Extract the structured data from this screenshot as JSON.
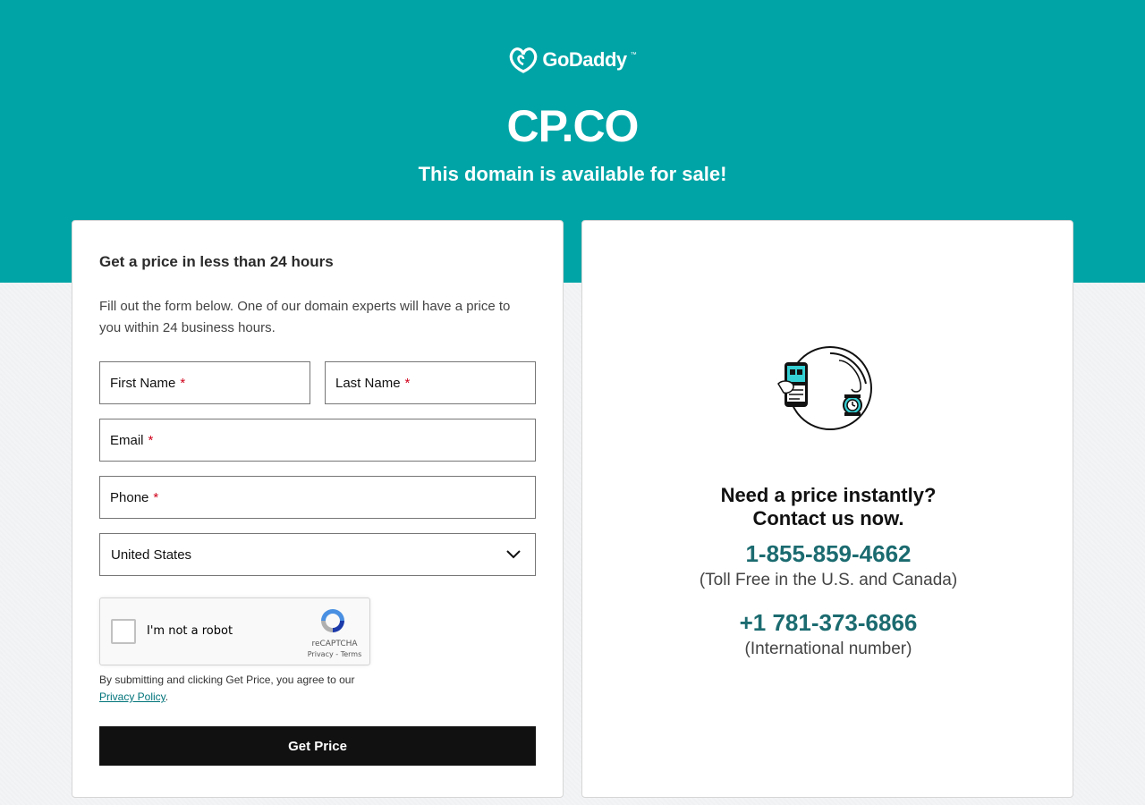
{
  "header": {
    "brand": "GoDaddy",
    "brand_mark": "™",
    "domain": "CP.CO",
    "subtitle": "This domain is available for sale!"
  },
  "form": {
    "heading": "Get a price in less than 24 hours",
    "description": "Fill out the form below. One of our domain experts will have a price to you within 24 business hours.",
    "first_name_label": "First Name",
    "last_name_label": "Last Name",
    "email_label": "Email",
    "phone_label": "Phone",
    "required_mark": "*",
    "country_value": "United States",
    "recaptcha_label": "I'm not a robot",
    "recaptcha_brand": "reCAPTCHA",
    "recaptcha_links": "Privacy - Terms",
    "consent_text": "By submitting and clicking Get Price, you agree to our",
    "privacy_link": "Privacy Policy",
    "consent_end": ".",
    "submit_label": "Get Price"
  },
  "contact": {
    "heading_line1": "Need a price instantly?",
    "heading_line2": "Contact us now.",
    "phone1": "1-855-859-4662",
    "phone1_note": "(Toll Free in the U.S. and Canada)",
    "phone2": "+1 781-373-6866",
    "phone2_note": "(International number)"
  },
  "colors": {
    "hero": "#00a4a6",
    "phone_text": "#1b6b70",
    "button": "#111111"
  },
  "icons": [
    "godaddy-logo-icon",
    "chevron-down-icon",
    "recaptcha-icon",
    "phone-watch-illustration"
  ]
}
